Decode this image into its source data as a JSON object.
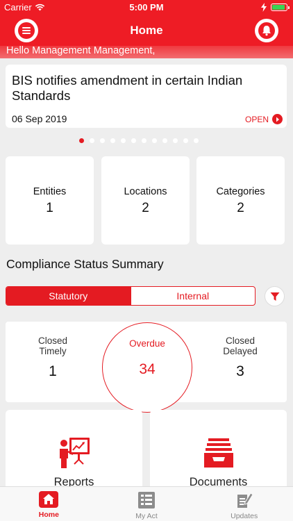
{
  "status_bar": {
    "carrier": "Carrier",
    "time": "5:00 PM"
  },
  "nav": {
    "title": "Home"
  },
  "greeting": "Hello Management Management,",
  "news": {
    "headline": "BIS notifies amendment in certain Indian Standards",
    "date": "06 Sep 2019",
    "open_label": "OPEN",
    "page_count": 12,
    "active_page": 0
  },
  "stats": [
    {
      "label": "Entities",
      "value": "1"
    },
    {
      "label": "Locations",
      "value": "2"
    },
    {
      "label": "Categories",
      "value": "2"
    }
  ],
  "compliance": {
    "title": "Compliance Status Summary",
    "tabs": {
      "statutory": "Statutory",
      "internal": "Internal"
    },
    "closed_timely": {
      "label_line1": "Closed",
      "label_line2": "Timely",
      "value": "1"
    },
    "overdue": {
      "label": "Overdue",
      "value": "34"
    },
    "closed_delayed": {
      "label_line1": "Closed",
      "label_line2": "Delayed",
      "value": "3"
    }
  },
  "tiles": {
    "reports": "Reports",
    "documents": "Documents"
  },
  "tabbar": {
    "home": "Home",
    "my_act": "My Act",
    "updates": "Updates"
  },
  "colors": {
    "brand_red": "#ee1c25",
    "accent_red": "#e41b22",
    "background": "#eeeeee"
  }
}
